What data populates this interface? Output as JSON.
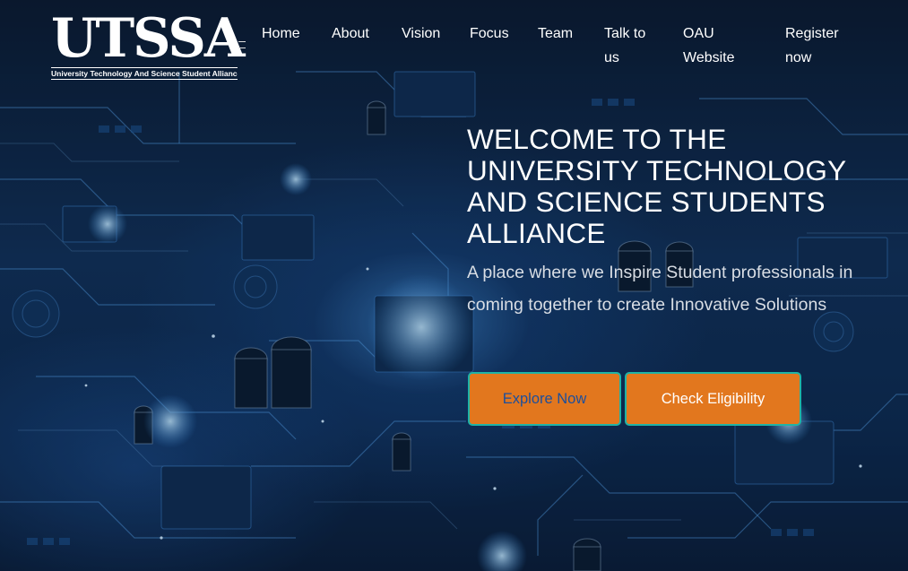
{
  "brand": {
    "name": "UTSSA",
    "tagline": "University Technology And Science Student Alliance."
  },
  "nav": {
    "items": [
      {
        "label": "Home"
      },
      {
        "label": "About"
      },
      {
        "label": "Vision"
      },
      {
        "label": "Focus"
      },
      {
        "label": "Team"
      },
      {
        "label": "Talk to us"
      },
      {
        "label": "OAU Website"
      },
      {
        "label": "Register now"
      }
    ]
  },
  "hero": {
    "headline": "WELCOME TO THE UNIVERSITY TECHNOLOGY AND SCIENCE STUDENTS ALLIANCE",
    "subtext": "A place where we Inspire Student professionals in coming together to create Innovative Solutions",
    "explore_label": "Explore Now",
    "eligibility_label": "Check Eligibility",
    "background_icon": "circuit-board-image"
  },
  "colors": {
    "button_fill": "#e2771e",
    "button_border": "#1fb3a6",
    "explore_text": "#1d4f9c",
    "background": "#0d2a50"
  }
}
